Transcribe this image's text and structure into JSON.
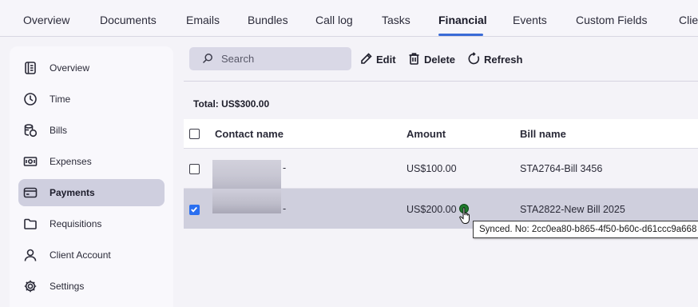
{
  "topnav": {
    "tabs": [
      {
        "label": "Overview"
      },
      {
        "label": "Documents"
      },
      {
        "label": "Emails"
      },
      {
        "label": "Bundles"
      },
      {
        "label": "Call log"
      },
      {
        "label": "Tasks"
      },
      {
        "label": "Financial"
      },
      {
        "label": "Events"
      },
      {
        "label": "Custom Fields"
      },
      {
        "label": "Clie"
      }
    ],
    "active": "Financial"
  },
  "sidebar": {
    "items": [
      {
        "label": "Overview",
        "icon": "document-list-icon"
      },
      {
        "label": "Time",
        "icon": "clock-icon"
      },
      {
        "label": "Bills",
        "icon": "coins-icon"
      },
      {
        "label": "Expenses",
        "icon": "banknote-icon"
      },
      {
        "label": "Payments",
        "icon": "card-icon"
      },
      {
        "label": "Requisitions",
        "icon": "folder-icon"
      },
      {
        "label": "Client Account",
        "icon": "person-icon"
      },
      {
        "label": "Settings",
        "icon": "gear-icon"
      }
    ],
    "active": "Payments"
  },
  "toolbar": {
    "search_placeholder": "Search",
    "edit_label": "Edit",
    "delete_label": "Delete",
    "refresh_label": "Refresh"
  },
  "summary": {
    "total": "Total: US$300.00"
  },
  "table": {
    "columns": [
      "Contact name",
      "Amount",
      "Bill name"
    ],
    "rows": [
      {
        "contact_suffix": "-",
        "amount": "US$100.00",
        "bill_name": "STA2764-Bill 3456",
        "checked": false
      },
      {
        "contact_suffix": "-",
        "amount": "US$200.00",
        "bill_name": "STA2822-New Bill 2025",
        "checked": true
      }
    ]
  },
  "tooltip": {
    "text": "Synced. No: 2cc0ea80-b865-4f50-b60c-d61ccc9a668"
  },
  "colors": {
    "accent": "#3a6bd6",
    "checkbox_checked": "#2a6ff0",
    "synced": "#1f7a2c",
    "selected_row": "#cfcfdd"
  }
}
